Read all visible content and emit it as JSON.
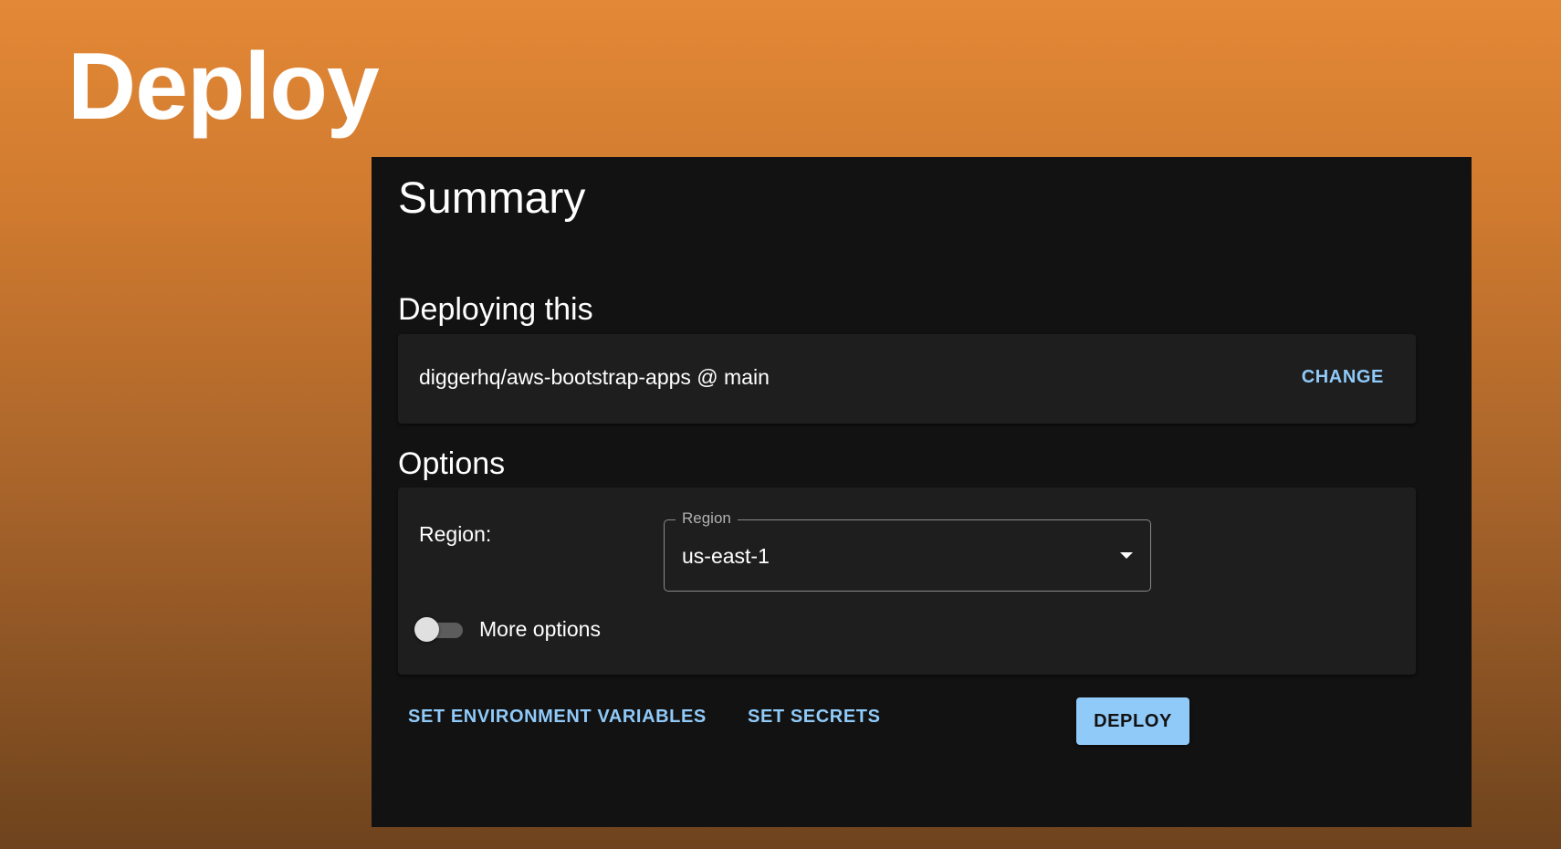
{
  "page": {
    "heading": "Deploy"
  },
  "summary": {
    "title": "Summary",
    "deploying": {
      "section_title": "Deploying this",
      "repo": "diggerhq/aws-bootstrap-apps @ main",
      "change_label": "CHANGE"
    },
    "options": {
      "section_title": "Options",
      "region_label": "Region:",
      "region_select": {
        "legend": "Region",
        "value": "us-east-1",
        "icon": "arrow-drop-down-icon"
      },
      "more_options": {
        "label": "More options",
        "enabled": false
      }
    },
    "actions": {
      "env_label": "SET ENVIRONMENT VARIABLES",
      "secrets_label": "SET SECRETS",
      "deploy_label": "DEPLOY"
    }
  },
  "colors": {
    "accent": "#90caf9",
    "panel": "#121212",
    "card": "#1e1e1e",
    "background_top": "#e38836",
    "background_bottom": "#6e431d"
  }
}
